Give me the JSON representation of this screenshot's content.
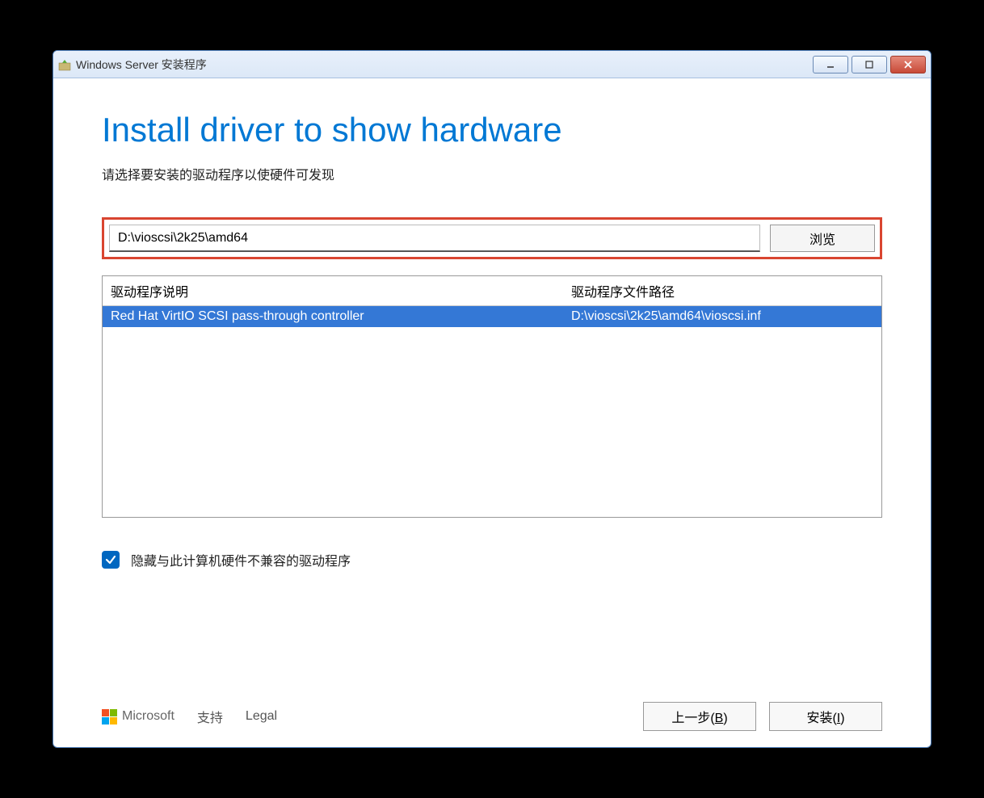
{
  "window": {
    "title": "Windows Server 安装程序"
  },
  "page": {
    "heading": "Install driver to show hardware",
    "subheading": "请选择要安装的驱动程序以使硬件可发现"
  },
  "path": {
    "value": "D:\\vioscsi\\2k25\\amd64",
    "browse_label": "浏览"
  },
  "list": {
    "col_desc": "驱动程序说明",
    "col_path": "驱动程序文件路径",
    "rows": [
      {
        "desc": "Red Hat VirtIO SCSI pass-through controller",
        "path": "D:\\vioscsi\\2k25\\amd64\\vioscsi.inf",
        "selected": true
      }
    ]
  },
  "checkbox": {
    "label": "隐藏与此计算机硬件不兼容的驱动程序",
    "checked": true
  },
  "footer": {
    "microsoft": "Microsoft",
    "support": "支持",
    "legal": "Legal",
    "back_label": "上一步(",
    "back_key": "B",
    "back_suffix": ")",
    "install_label": "安装(",
    "install_key": "I",
    "install_suffix": ")"
  }
}
